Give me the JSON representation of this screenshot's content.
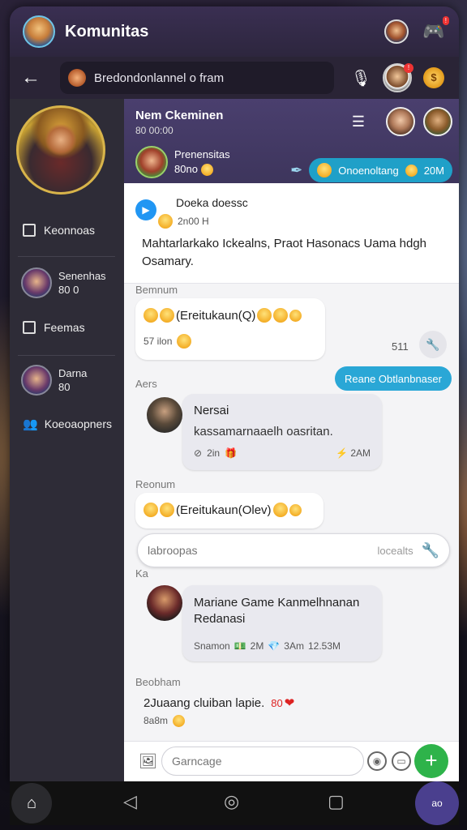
{
  "app": {
    "title": "Komunitas"
  },
  "secbar": {
    "channel": "Bredondonlannel o fram"
  },
  "sidebar": {
    "items": [
      {
        "label": "Keonnoas"
      },
      {
        "label": "Feemas"
      },
      {
        "label": "Koeoaopners"
      }
    ],
    "users": [
      {
        "name": "Senenhas",
        "sub": "80 0"
      },
      {
        "name": "Darna",
        "sub": "80"
      }
    ]
  },
  "chat_header": {
    "name": "Nem Ckeminen",
    "sub": "80 00:00",
    "member_name": "Prenensitas",
    "member_sub": "80no",
    "action_label": "Onoenoltang",
    "action_count": "20M"
  },
  "pinned": {
    "author": "Doeka doessc",
    "meta": "2n00 H",
    "text": "Mahtarlarkako Ickealns, Praot Hasonacs Uama hdgh Osamary."
  },
  "sections": {
    "s1": "Bemnum",
    "s2": "Aers",
    "s3": "Reonum",
    "s4": "Ka",
    "s5": "Beobham"
  },
  "messages": {
    "m1_text": "(Ereitukaun(Q)",
    "m1_time": "57 ilon",
    "m1_count": "511",
    "reply_chip": "Reane Obtlanbnaser",
    "m2_author": "Nersai",
    "m2_text": "kassamarnaaelh oasritan.",
    "m2_time": "2in",
    "m2_time2": "2AM",
    "m3_text": "(Ereitukaun(Olev)",
    "search_placeholder": "labroopas",
    "search_hint": "locealts",
    "m4_text": "Mariane Game Kanmelhnanan Redanasi",
    "m4_meta1": "Snamon",
    "m4_meta2": "2M",
    "m4_meta3": "3Am",
    "m4_meta4": "12.53M",
    "m5_text": "2Juaang cluiban lapie.",
    "m5_count": "80",
    "m5_time": "8a8m"
  },
  "composer": {
    "placeholder": "Garncage"
  },
  "navbar": {
    "corner_label": "ao"
  }
}
